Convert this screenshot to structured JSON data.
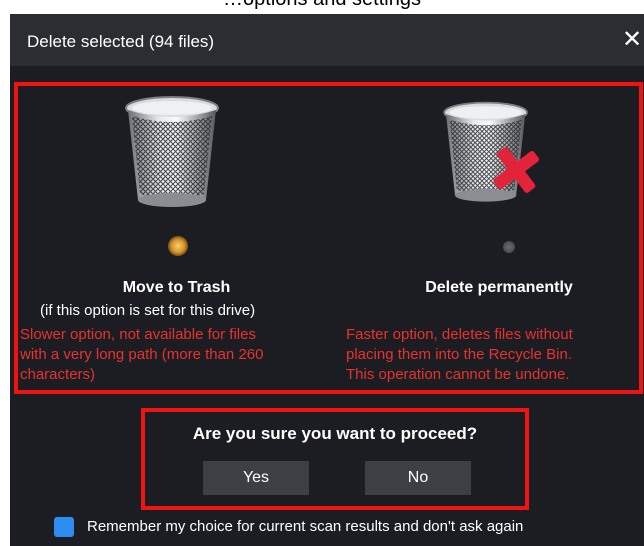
{
  "page": {
    "top_caption": "…options and settings"
  },
  "dialog": {
    "title": "Delete selected (94 files)"
  },
  "options": [
    {
      "title": "Move to Trash",
      "subtitle": "(if this option is set for this drive)",
      "warning_lines": [
        "Slower option, not available for files",
        "with a very long path (more than 260",
        "characters)"
      ],
      "selected": true
    },
    {
      "title": "Delete permanently",
      "subtitle": "",
      "warning_lines": [
        "Faster option, deletes files without",
        "placing them into the Recycle Bin.",
        "This operation cannot be undone."
      ],
      "selected": false
    }
  ],
  "confirm": {
    "question": "Are you sure you want to proceed?",
    "yes_label": "Yes",
    "no_label": "No"
  },
  "remember": {
    "label": "Remember my choice for current scan results and don't ask again",
    "checked": true
  },
  "colors": {
    "highlight_border": "#ef1313",
    "warning_text": "#e8322e",
    "checkbox": "#2d8cf0",
    "dialog_bg": "#1b1d22",
    "titlebar_bg": "#2b2d32",
    "button_bg": "#3d3f44"
  },
  "icons": {
    "close": "close-icon",
    "trash": "trash-bin-icon",
    "trash_delete": "trash-bin-delete-icon",
    "radio": "radio-button-icon",
    "checkbox": "checkbox-icon"
  }
}
